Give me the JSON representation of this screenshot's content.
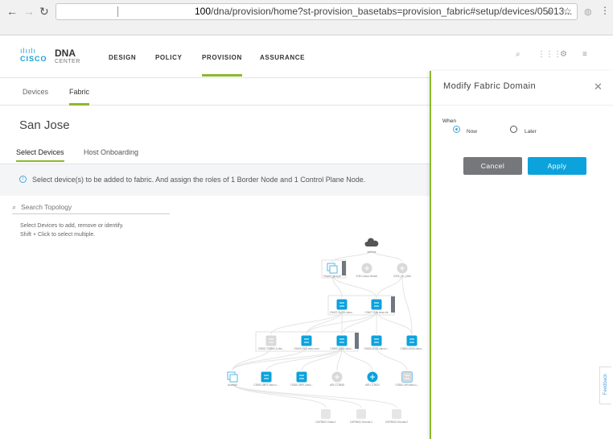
{
  "browser": {
    "url_host_part": "100",
    "url_rest": "/dna/provision/home?st-provision_basetabs=provision_fabric#setup/devices/05013..."
  },
  "header": {
    "logo_brand": "CISCO",
    "logo_product": "DNA",
    "logo_sub": "CENTER",
    "nav": [
      "DESIGN",
      "POLICY",
      "PROVISION",
      "ASSURANCE"
    ],
    "active_nav": "PROVISION"
  },
  "tabs": {
    "items": [
      "Devices",
      "Fabric"
    ],
    "active": "Fabric"
  },
  "page": {
    "title": "San Jose",
    "subtabs": [
      "Select Devices",
      "Host Onboarding"
    ],
    "active_subtab": "Select Devices",
    "info": "Select device(s) to be added to fabric. And assign the roles of 1 Border Node and 1 Control Plane Node.",
    "search_placeholder": "Search Topology",
    "help_line1": "Select Devices to add, remove or identify.",
    "help_line2": "Shift + Click to select multiple."
  },
  "topology": {
    "colors": {
      "selected": "#0ca3dc",
      "unselected": "#d9d9d9",
      "cloud": "#555555"
    },
    "nodes": [
      {
        "id": "internet",
        "type": "cloud",
        "label": "Internet"
      },
      {
        "id": "rg",
        "type": "group",
        "label": "Router_group0"
      },
      {
        "id": "r1",
        "type": "router",
        "label": "ICR1-Cisco-Server",
        "selected": false
      },
      {
        "id": "r2",
        "type": "router",
        "label": "ICR3_LE_x284",
        "selected": false
      },
      {
        "id": "s1",
        "type": "switch",
        "label": "C9407-SL-B2.cisco...",
        "selected": true
      },
      {
        "id": "s2",
        "type": "switch",
        "label": "C9407-S1A.cisco.int",
        "selected": true
      },
      {
        "id": "s3",
        "type": "switch",
        "label": "C9300-T2SDR-2.cisc...",
        "selected": false
      },
      {
        "id": "s4",
        "type": "switch",
        "label": "C9400-S1E.cisco.com",
        "selected": true
      },
      {
        "id": "s5",
        "type": "switch",
        "label": "C9400-D001.cisco...",
        "selected": true
      },
      {
        "id": "s6",
        "type": "switch",
        "label": "C9400-D021.cisco.c...",
        "selected": true
      },
      {
        "id": "s7",
        "type": "switch",
        "label": "C9400-D002.cisco...",
        "selected": true
      },
      {
        "id": "ag",
        "type": "group",
        "label": "Access0"
      },
      {
        "id": "a1",
        "type": "switch",
        "label": "C9300-48P2.cisco.c...",
        "selected": true
      },
      {
        "id": "a2",
        "type": "switch",
        "label": "C9300-48P1.cisco...",
        "selected": true
      },
      {
        "id": "a3",
        "type": "router",
        "label": "AIR-CT5508",
        "selected": false
      },
      {
        "id": "a4",
        "type": "router",
        "label": "AIR-CT5520",
        "selected": true
      },
      {
        "id": "a5",
        "type": "switch",
        "label": "C9300-24P.cisco.c...",
        "selected": false,
        "highlighted": true
      },
      {
        "id": "ap1",
        "type": "ap",
        "label": "CAP3602-Class-1",
        "selected": false
      },
      {
        "id": "ap2",
        "type": "ap",
        "label": "CAP3602-Ground-1",
        "selected": false
      },
      {
        "id": "ap3",
        "type": "ap",
        "label": "CAP3602-Ground-2",
        "selected": false
      }
    ],
    "edges": [
      [
        "internet",
        "rg"
      ],
      [
        "internet",
        "r2"
      ],
      [
        "rg",
        "s1"
      ],
      [
        "rg",
        "s2"
      ],
      [
        "r2",
        "s2"
      ],
      [
        "r2",
        "s7"
      ],
      [
        "s1",
        "s3"
      ],
      [
        "s1",
        "s4"
      ],
      [
        "s1",
        "s5"
      ],
      [
        "s2",
        "s4"
      ],
      [
        "s2",
        "s5"
      ],
      [
        "s2",
        "s6"
      ],
      [
        "s2",
        "s7"
      ],
      [
        "s4",
        "ag"
      ],
      [
        "s5",
        "ag"
      ],
      [
        "s5",
        "a1"
      ],
      [
        "s5",
        "a2"
      ],
      [
        "s5",
        "a3"
      ],
      [
        "s5",
        "a4"
      ],
      [
        "s6",
        "a5"
      ],
      [
        "s3",
        "ag"
      ],
      [
        "ag",
        "ap1"
      ],
      [
        "ag",
        "ap2"
      ],
      [
        "ag",
        "ap3"
      ]
    ]
  },
  "panel": {
    "title": "Modify Fabric Domain",
    "when_label": "When",
    "options": [
      "Now",
      "Later"
    ],
    "selected_option": "Now",
    "cancel": "Cancel",
    "apply": "Apply"
  },
  "feedback": "Feedback"
}
